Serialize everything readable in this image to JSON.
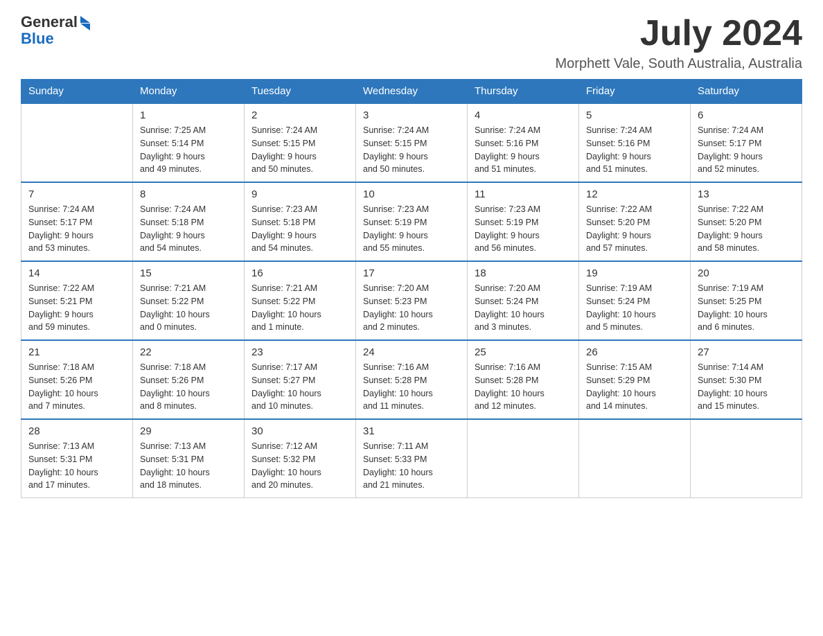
{
  "header": {
    "logo": {
      "general": "General",
      "blue": "Blue"
    },
    "month_year": "July 2024",
    "location": "Morphett Vale, South Australia, Australia"
  },
  "days_of_week": [
    "Sunday",
    "Monday",
    "Tuesday",
    "Wednesday",
    "Thursday",
    "Friday",
    "Saturday"
  ],
  "weeks": [
    {
      "days": [
        {
          "number": "",
          "info": ""
        },
        {
          "number": "1",
          "info": "Sunrise: 7:25 AM\nSunset: 5:14 PM\nDaylight: 9 hours\nand 49 minutes."
        },
        {
          "number": "2",
          "info": "Sunrise: 7:24 AM\nSunset: 5:15 PM\nDaylight: 9 hours\nand 50 minutes."
        },
        {
          "number": "3",
          "info": "Sunrise: 7:24 AM\nSunset: 5:15 PM\nDaylight: 9 hours\nand 50 minutes."
        },
        {
          "number": "4",
          "info": "Sunrise: 7:24 AM\nSunset: 5:16 PM\nDaylight: 9 hours\nand 51 minutes."
        },
        {
          "number": "5",
          "info": "Sunrise: 7:24 AM\nSunset: 5:16 PM\nDaylight: 9 hours\nand 51 minutes."
        },
        {
          "number": "6",
          "info": "Sunrise: 7:24 AM\nSunset: 5:17 PM\nDaylight: 9 hours\nand 52 minutes."
        }
      ]
    },
    {
      "days": [
        {
          "number": "7",
          "info": "Sunrise: 7:24 AM\nSunset: 5:17 PM\nDaylight: 9 hours\nand 53 minutes."
        },
        {
          "number": "8",
          "info": "Sunrise: 7:24 AM\nSunset: 5:18 PM\nDaylight: 9 hours\nand 54 minutes."
        },
        {
          "number": "9",
          "info": "Sunrise: 7:23 AM\nSunset: 5:18 PM\nDaylight: 9 hours\nand 54 minutes."
        },
        {
          "number": "10",
          "info": "Sunrise: 7:23 AM\nSunset: 5:19 PM\nDaylight: 9 hours\nand 55 minutes."
        },
        {
          "number": "11",
          "info": "Sunrise: 7:23 AM\nSunset: 5:19 PM\nDaylight: 9 hours\nand 56 minutes."
        },
        {
          "number": "12",
          "info": "Sunrise: 7:22 AM\nSunset: 5:20 PM\nDaylight: 9 hours\nand 57 minutes."
        },
        {
          "number": "13",
          "info": "Sunrise: 7:22 AM\nSunset: 5:20 PM\nDaylight: 9 hours\nand 58 minutes."
        }
      ]
    },
    {
      "days": [
        {
          "number": "14",
          "info": "Sunrise: 7:22 AM\nSunset: 5:21 PM\nDaylight: 9 hours\nand 59 minutes."
        },
        {
          "number": "15",
          "info": "Sunrise: 7:21 AM\nSunset: 5:22 PM\nDaylight: 10 hours\nand 0 minutes."
        },
        {
          "number": "16",
          "info": "Sunrise: 7:21 AM\nSunset: 5:22 PM\nDaylight: 10 hours\nand 1 minute."
        },
        {
          "number": "17",
          "info": "Sunrise: 7:20 AM\nSunset: 5:23 PM\nDaylight: 10 hours\nand 2 minutes."
        },
        {
          "number": "18",
          "info": "Sunrise: 7:20 AM\nSunset: 5:24 PM\nDaylight: 10 hours\nand 3 minutes."
        },
        {
          "number": "19",
          "info": "Sunrise: 7:19 AM\nSunset: 5:24 PM\nDaylight: 10 hours\nand 5 minutes."
        },
        {
          "number": "20",
          "info": "Sunrise: 7:19 AM\nSunset: 5:25 PM\nDaylight: 10 hours\nand 6 minutes."
        }
      ]
    },
    {
      "days": [
        {
          "number": "21",
          "info": "Sunrise: 7:18 AM\nSunset: 5:26 PM\nDaylight: 10 hours\nand 7 minutes."
        },
        {
          "number": "22",
          "info": "Sunrise: 7:18 AM\nSunset: 5:26 PM\nDaylight: 10 hours\nand 8 minutes."
        },
        {
          "number": "23",
          "info": "Sunrise: 7:17 AM\nSunset: 5:27 PM\nDaylight: 10 hours\nand 10 minutes."
        },
        {
          "number": "24",
          "info": "Sunrise: 7:16 AM\nSunset: 5:28 PM\nDaylight: 10 hours\nand 11 minutes."
        },
        {
          "number": "25",
          "info": "Sunrise: 7:16 AM\nSunset: 5:28 PM\nDaylight: 10 hours\nand 12 minutes."
        },
        {
          "number": "26",
          "info": "Sunrise: 7:15 AM\nSunset: 5:29 PM\nDaylight: 10 hours\nand 14 minutes."
        },
        {
          "number": "27",
          "info": "Sunrise: 7:14 AM\nSunset: 5:30 PM\nDaylight: 10 hours\nand 15 minutes."
        }
      ]
    },
    {
      "days": [
        {
          "number": "28",
          "info": "Sunrise: 7:13 AM\nSunset: 5:31 PM\nDaylight: 10 hours\nand 17 minutes."
        },
        {
          "number": "29",
          "info": "Sunrise: 7:13 AM\nSunset: 5:31 PM\nDaylight: 10 hours\nand 18 minutes."
        },
        {
          "number": "30",
          "info": "Sunrise: 7:12 AM\nSunset: 5:32 PM\nDaylight: 10 hours\nand 20 minutes."
        },
        {
          "number": "31",
          "info": "Sunrise: 7:11 AM\nSunset: 5:33 PM\nDaylight: 10 hours\nand 21 minutes."
        },
        {
          "number": "",
          "info": ""
        },
        {
          "number": "",
          "info": ""
        },
        {
          "number": "",
          "info": ""
        }
      ]
    }
  ]
}
